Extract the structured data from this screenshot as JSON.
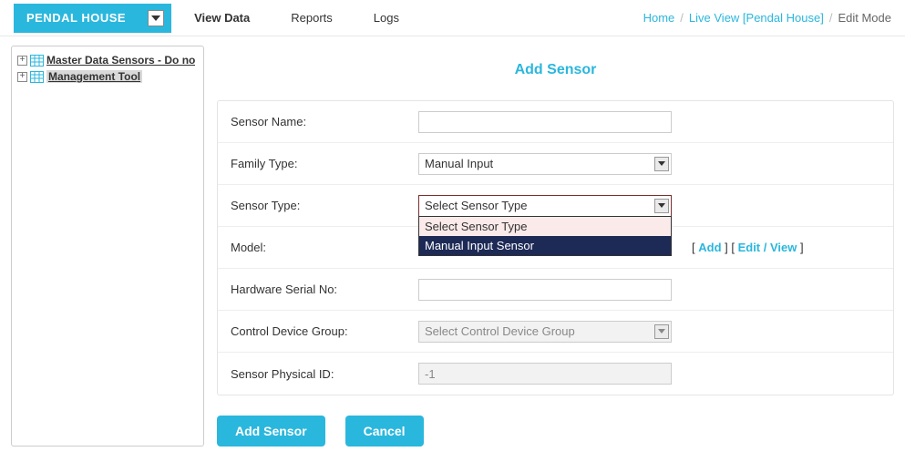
{
  "topbar": {
    "house": "PENDAL HOUSE",
    "nav": {
      "view": "View Data",
      "reports": "Reports",
      "logs": "Logs"
    }
  },
  "breadcrumb": {
    "home": "Home",
    "live": "Live View [Pendal House]",
    "current": "Edit Mode"
  },
  "tree": {
    "items": [
      {
        "label": "Master Data Sensors - Do no"
      },
      {
        "label": "Management Tool"
      }
    ]
  },
  "page": {
    "title": "Add Sensor"
  },
  "form": {
    "sensor_name": {
      "label": "Sensor Name:",
      "value": ""
    },
    "family_type": {
      "label": "Family Type:",
      "value": "Manual Input"
    },
    "sensor_type": {
      "label": "Sensor Type:",
      "value": "Select Sensor Type",
      "options": [
        {
          "label": "Select Sensor Type"
        },
        {
          "label": "Manual Input Sensor"
        }
      ]
    },
    "model": {
      "label": "Model:",
      "add": "Add",
      "edit": "Edit / View"
    },
    "hw_serial": {
      "label": "Hardware Serial No:",
      "value": ""
    },
    "ctrl_group": {
      "label": "Control Device Group:",
      "value": "Select Control Device Group"
    },
    "phys_id": {
      "label": "Sensor Physical ID:",
      "value": "-1"
    }
  },
  "buttons": {
    "add": "Add Sensor",
    "cancel": "Cancel"
  }
}
